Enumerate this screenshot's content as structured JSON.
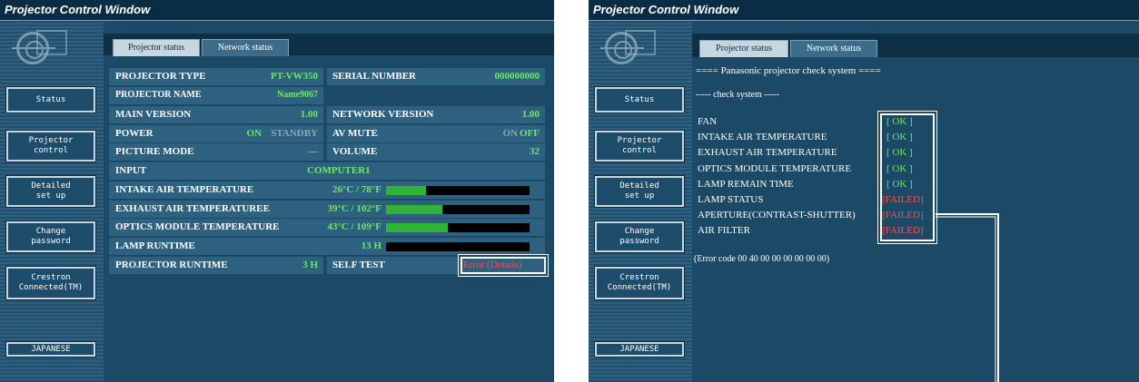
{
  "left": {
    "window_title": "Projector Control Window",
    "tabs": [
      {
        "label": "Projector status"
      },
      {
        "label": "Network status"
      }
    ],
    "nav": [
      {
        "label": "Status"
      },
      {
        "label": "Projector\ncontrol"
      },
      {
        "label": "Detailed\nset up"
      },
      {
        "label": "Change\npassword"
      },
      {
        "label": "Crestron\nConnected(TM)"
      },
      {
        "label": "JAPANESE"
      }
    ],
    "rows": {
      "projector_type": {
        "label": "PROJECTOR TYPE",
        "value": "PT-VW350"
      },
      "serial_number": {
        "label": "SERIAL NUMBER",
        "value": "000000000"
      },
      "projector_name": {
        "label": "PROJECTOR NAME",
        "value": "Name9067"
      },
      "main_version": {
        "label": "MAIN VERSION",
        "value": "1.00"
      },
      "network_version": {
        "label": "NETWORK VERSION",
        "value": "1.00"
      },
      "power": {
        "label": "POWER",
        "on": "ON",
        "standby": "STANDBY"
      },
      "av_mute": {
        "label": "AV MUTE",
        "on": "ON",
        "off": "OFF"
      },
      "picture_mode": {
        "label": "PICTURE MODE",
        "value": "---"
      },
      "volume": {
        "label": "VOLUME",
        "value": "32"
      },
      "input": {
        "label": "INPUT",
        "value": "COMPUTER1"
      },
      "intake_temp": {
        "label": "INTAKE AIR TEMPERATURE",
        "value": "26°C / 78°F",
        "level": 0.28
      },
      "exhaust_temp": {
        "label": "EXHAUST AIR TEMPERATUREE",
        "value": "39°C / 102°F",
        "level": 0.39
      },
      "optics_temp": {
        "label": "OPTICS MODULE TEMPERATURE",
        "value": "43°C / 109°F",
        "level": 0.43
      },
      "lamp_runtime": {
        "label": "LAMP RUNTIME",
        "value": "13 H",
        "level": 0.0
      },
      "projector_runtime": {
        "label": "PROJECTOR RUNTIME",
        "value": "3 H"
      },
      "self_test": {
        "label": "SELF TEST",
        "value": "Error (Details)"
      }
    }
  },
  "right": {
    "window_title": "Projector Control Window",
    "tabs": [
      {
        "label": "Projector status"
      },
      {
        "label": "Network status"
      }
    ],
    "nav": [
      {
        "label": "Status"
      },
      {
        "label": "Projector\ncontrol"
      },
      {
        "label": "Detailed\nset up"
      },
      {
        "label": "Change\npassword"
      },
      {
        "label": "Crestron\nConnected(TM)"
      },
      {
        "label": "JAPANESE"
      }
    ],
    "header": "==== Panasonic projector check system ====",
    "subheader": "----- check system -----",
    "checks": [
      {
        "label": "FAN",
        "status": "[ OK ]"
      },
      {
        "label": "INTAKE AIR TEMPERATURE",
        "status": "[ OK ]"
      },
      {
        "label": "EXHAUST  AIR  TEMPERATURE",
        "status": "[ OK ]"
      },
      {
        "label": "OPTICS MODULE TEMPERATURE",
        "status": "[ OK ]"
      },
      {
        "label": "LAMP REMAIN TIME",
        "status": "[ OK ]"
      },
      {
        "label": "LAMP STATUS",
        "status": "[FAILED]"
      },
      {
        "label": "APERTURE(CONTRAST-SHUTTER)",
        "status": "[FAILED]"
      },
      {
        "label": "AIR FILTER",
        "status": "[FAILED]"
      }
    ],
    "error_code": "(Error code 00 40 00 00 00 00 00 00)"
  },
  "colors": {
    "ok": "#6be86b",
    "failed": "#ff4c4c",
    "panel": "#1c4a66",
    "bar": "#2fb437"
  }
}
